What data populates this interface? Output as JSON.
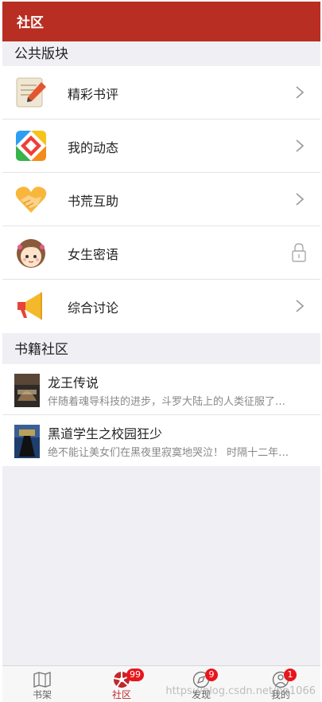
{
  "header": {
    "title": "社区"
  },
  "public_section": {
    "title": "公共版块",
    "items": [
      {
        "label": "精彩书评",
        "icon": "notepad-pencil-icon",
        "trailing": "chevron"
      },
      {
        "label": "我的动态",
        "icon": "colorful-diamond-icon",
        "trailing": "chevron"
      },
      {
        "label": "书荒互助",
        "icon": "handshake-heart-icon",
        "trailing": "chevron"
      },
      {
        "label": "女生密语",
        "icon": "girl-avatar-icon",
        "trailing": "lock"
      },
      {
        "label": "综合讨论",
        "icon": "megaphone-icon",
        "trailing": "chevron"
      }
    ]
  },
  "book_section": {
    "title": "书籍社区",
    "items": [
      {
        "title": "龙王传说",
        "desc": "伴随着魂导科技的进步，斗罗大陆上的人类征服了…"
      },
      {
        "title": "黑道学生之校园狂少",
        "desc": "绝不能让美女们在黑夜里寂寞地哭泣！ 时隔十二年…"
      }
    ]
  },
  "tabbar": {
    "tabs": [
      {
        "label": "书架",
        "icon": "map-icon",
        "badge": ""
      },
      {
        "label": "社区",
        "icon": "community-icon",
        "badge": "99"
      },
      {
        "label": "发现",
        "icon": "compass-icon",
        "badge": "9"
      },
      {
        "label": "我的",
        "icon": "profile-icon",
        "badge": "1"
      }
    ]
  },
  "watermark": "https://blog.csdn.net/pp1066",
  "colors": {
    "accent": "#b92e22",
    "badge": "#e8161b",
    "background": "#efeff4"
  }
}
